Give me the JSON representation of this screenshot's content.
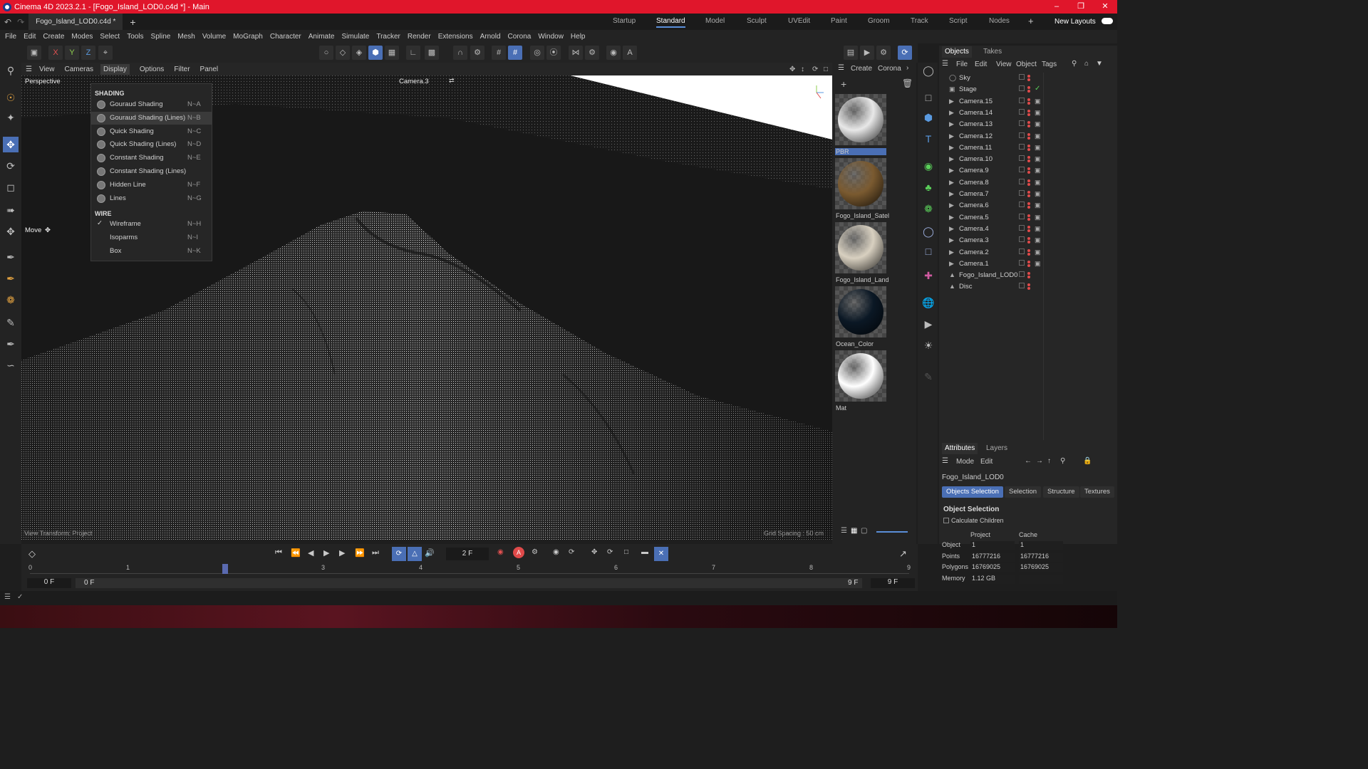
{
  "app": {
    "title": "Cinema 4D 2023.2.1 - [Fogo_Island_LOD0.c4d *] - Main"
  },
  "doc_tab": "Fogo_Island_LOD0.c4d *",
  "layouts": [
    "Startup",
    "Standard",
    "Model",
    "Sculpt",
    "UVEdit",
    "Paint",
    "Groom",
    "Track",
    "Script",
    "Nodes"
  ],
  "new_layouts": "New Layouts",
  "menus": [
    "File",
    "Edit",
    "Create",
    "Modes",
    "Select",
    "Tools",
    "Spline",
    "Mesh",
    "Volume",
    "MoGraph",
    "Character",
    "Animate",
    "Simulate",
    "Tracker",
    "Render",
    "Extensions",
    "Arnold",
    "Corona",
    "Window",
    "Help"
  ],
  "coord": {
    "x": "X",
    "y": "Y",
    "z": "Z"
  },
  "viewport": {
    "menu": [
      "View",
      "Cameras",
      "Display",
      "Options",
      "Filter",
      "Panel"
    ],
    "label": "Perspective",
    "camera": "Camera.3",
    "status_left": "View Transform: Project",
    "status_right": "Grid Spacing : 50 cm",
    "tool_label": "Move"
  },
  "display_menu": {
    "shading_header": "SHADING",
    "wire_header": "WIRE",
    "shading": [
      {
        "label": "Gouraud Shading",
        "sc": "N~A"
      },
      {
        "label": "Gouraud Shading (Lines)",
        "sc": "N~B"
      },
      {
        "label": "Quick Shading",
        "sc": "N~C"
      },
      {
        "label": "Quick Shading (Lines)",
        "sc": "N~D"
      },
      {
        "label": "Constant Shading",
        "sc": "N~E"
      },
      {
        "label": "Constant Shading (Lines)",
        "sc": ""
      },
      {
        "label": "Hidden Line",
        "sc": "N~F"
      },
      {
        "label": "Lines",
        "sc": "N~G"
      }
    ],
    "wire": [
      {
        "label": "Wireframe",
        "sc": "N~H",
        "checked": true
      },
      {
        "label": "Isoparms",
        "sc": "N~I"
      },
      {
        "label": "Box",
        "sc": "N~K"
      }
    ]
  },
  "materials": {
    "menu": [
      "Create",
      "Corona"
    ],
    "items": [
      {
        "name": "PBR",
        "color": "#e8e8e8"
      },
      {
        "name": "Fogo_Island_Satel",
        "color": "#7a5a30"
      },
      {
        "name": "Fogo_Island_Land",
        "color": "#d8d0c0"
      },
      {
        "name": "Ocean_Color",
        "color": "#0b1825"
      },
      {
        "name": "Mat",
        "color": "#ffffff"
      }
    ]
  },
  "objects": {
    "tabs": [
      "Objects",
      "Takes"
    ],
    "menu": [
      "File",
      "Edit",
      "View",
      "Object",
      "Tags"
    ],
    "items": [
      "Sky",
      "Stage",
      "Camera.15",
      "Camera.14",
      "Camera.13",
      "Camera.12",
      "Camera.11",
      "Camera.10",
      "Camera.9",
      "Camera.8",
      "Camera.7",
      "Camera.6",
      "Camera.5",
      "Camera.4",
      "Camera.3",
      "Camera.2",
      "Camera.1",
      "Fogo_Island_LOD0",
      "Disc"
    ]
  },
  "attributes": {
    "tabs": [
      "Attributes",
      "Layers"
    ],
    "menu": [
      "Mode",
      "Edit"
    ],
    "object_name": "Fogo_Island_LOD0",
    "buttons": [
      "Objects Selection",
      "Selection",
      "Structure",
      "Textures"
    ],
    "section": "Object Selection",
    "calc_children": "Calculate Children",
    "col_project": "Project",
    "col_cache": "Cache",
    "rows": [
      {
        "label": "Object",
        "project": "1",
        "cache": "1"
      },
      {
        "label": "Points",
        "project": "16777216",
        "cache": "16777216"
      },
      {
        "label": "Polygons",
        "project": "16769025",
        "cache": "16769025"
      },
      {
        "label": "Memory",
        "project": "1.12 GB",
        "cache": ""
      }
    ]
  },
  "timeline": {
    "frame": "2 F",
    "ticks": [
      "0",
      "1",
      "2",
      "3",
      "4",
      "5",
      "6",
      "7",
      "8",
      "9"
    ],
    "start": "0 F",
    "start2": "0 F",
    "end": "9 F",
    "end2": "9 F"
  }
}
